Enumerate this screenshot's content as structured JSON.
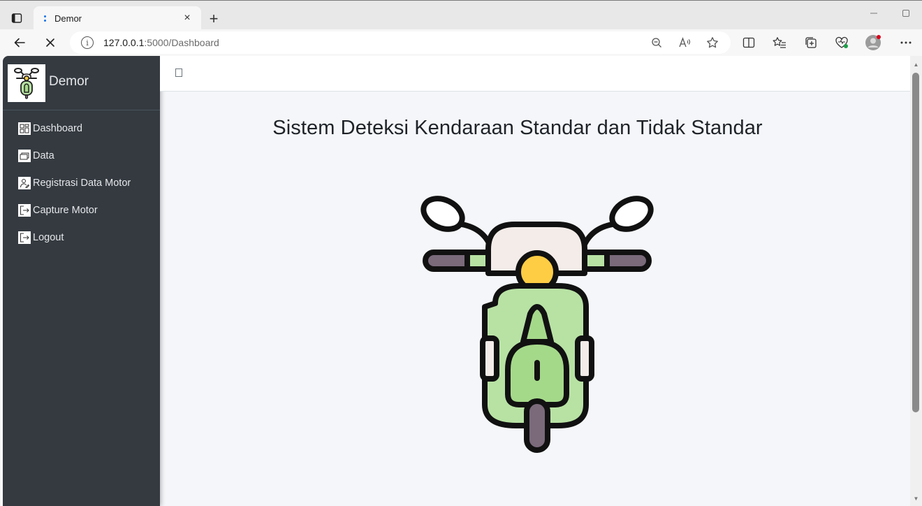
{
  "browser": {
    "tab_title": "Demor",
    "url_host": "127.0.0.1",
    "url_rest": ":5000/Dashboard",
    "new_tab_symbol": "+",
    "tab_close_symbol": "×"
  },
  "sidebar": {
    "brand_name": "Demor",
    "items": [
      {
        "label": "Dashboard",
        "icon": "dashboard-icon"
      },
      {
        "label": "Data",
        "icon": "data-icon"
      },
      {
        "label": "Registrasi Data Motor",
        "icon": "register-icon"
      },
      {
        "label": "Capture Motor",
        "icon": "capture-icon"
      },
      {
        "label": "Logout",
        "icon": "logout-icon"
      }
    ]
  },
  "main": {
    "title": "Sistem Deteksi Kendaraan Standar dan Tidak Standar"
  },
  "colors": {
    "sidebar_bg": "#343a40",
    "content_bg": "#f4f6f9",
    "scooter_body": "#b8e2a4",
    "scooter_light": "#ffcd44"
  }
}
